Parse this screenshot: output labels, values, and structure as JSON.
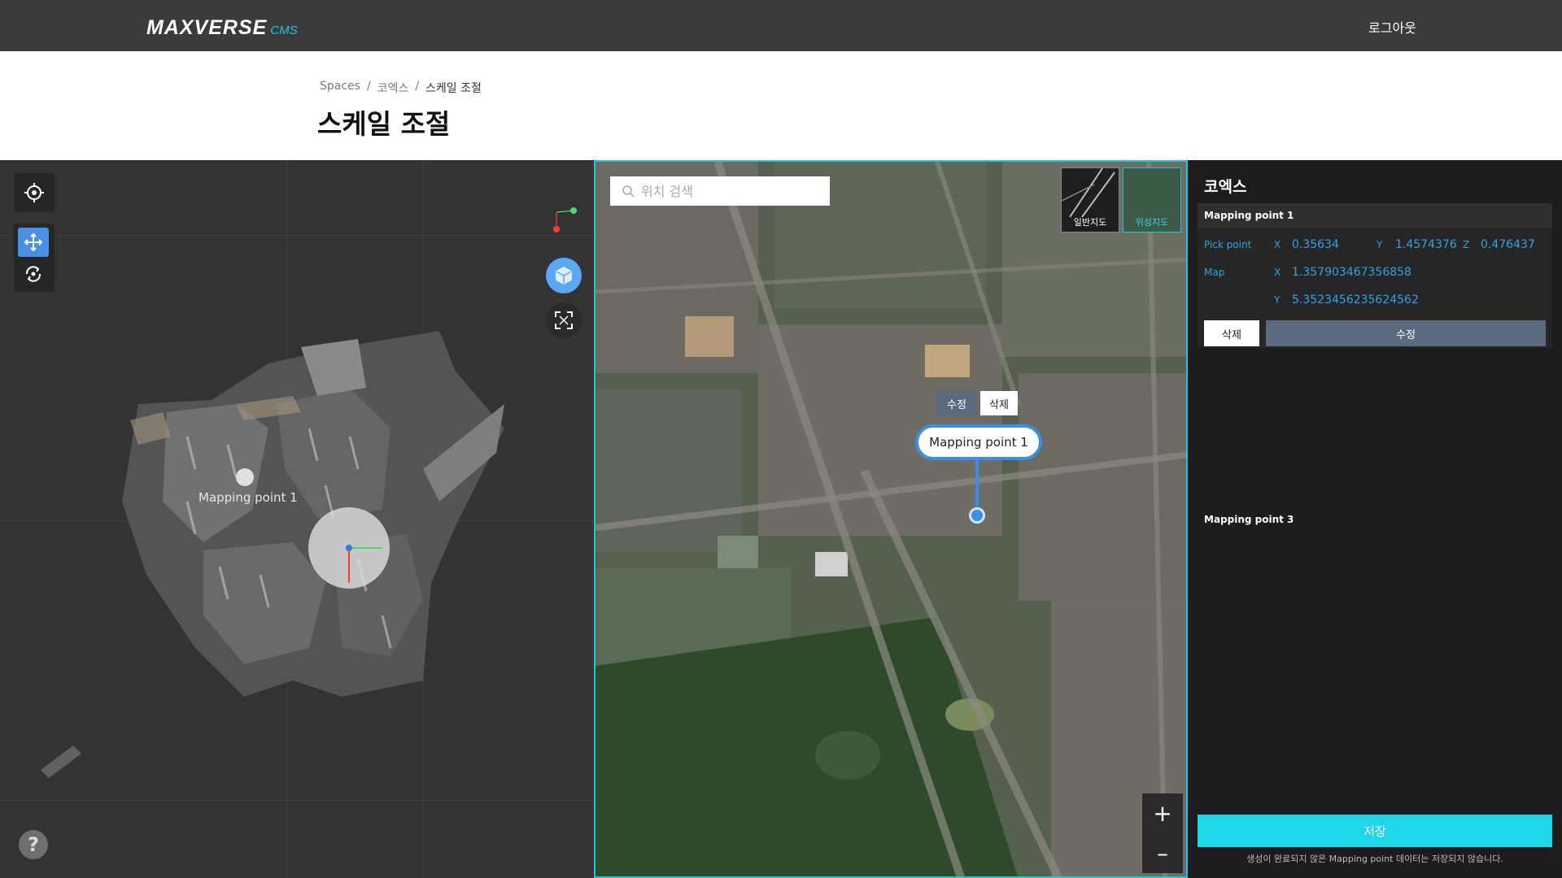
{
  "header": {
    "logo_main": "MAXVERSE",
    "logo_sub": "CMS",
    "logout": "로그아웃"
  },
  "breadcrumb": [
    "Spaces",
    "코엑스",
    "스케일 조절"
  ],
  "breadcrumb_sep": "/",
  "page_title": "스케일 조절",
  "viewer": {
    "point_label": "Mapping point 1",
    "help": "?",
    "axis_x": "X",
    "axis_y": "Y"
  },
  "map": {
    "search_placeholder": "위치 검색",
    "map_type_normal": "일반지도",
    "map_type_satellite": "위성지도",
    "selected_map_type": "위성지도",
    "pin_edit": "수정",
    "pin_delete": "삭제",
    "pin_label": "Mapping point 1",
    "zoom_in": "+",
    "zoom_out": "–"
  },
  "panel": {
    "title": "코엑스",
    "card": {
      "name": "Mapping point 1",
      "pick_label": "Pick point",
      "pick_x_label": "X",
      "pick_x": "0.35634",
      "pick_y_label": "Y",
      "pick_y": "1.4574376",
      "pick_z_label": "Z",
      "pick_z": "0.476437",
      "map_label": "Map",
      "map_x_label": "X",
      "map_x": "1.357903467356858",
      "map_y_label": "Y",
      "map_y": "5.3523456235624562",
      "delete": "삭제",
      "edit": "수정"
    },
    "other_point": "Mapping point 3",
    "save": "저장",
    "notice": "생성이 완료되지 않은 Mapping point 데이터는 저장되지 않습니다."
  },
  "colors": {
    "accent": "#1fd6e8",
    "pin_blue": "#3a8ee6",
    "header_bg": "#3b3b3b",
    "panel_bg": "#1c1c1c",
    "viewer_bg": "#333333"
  }
}
